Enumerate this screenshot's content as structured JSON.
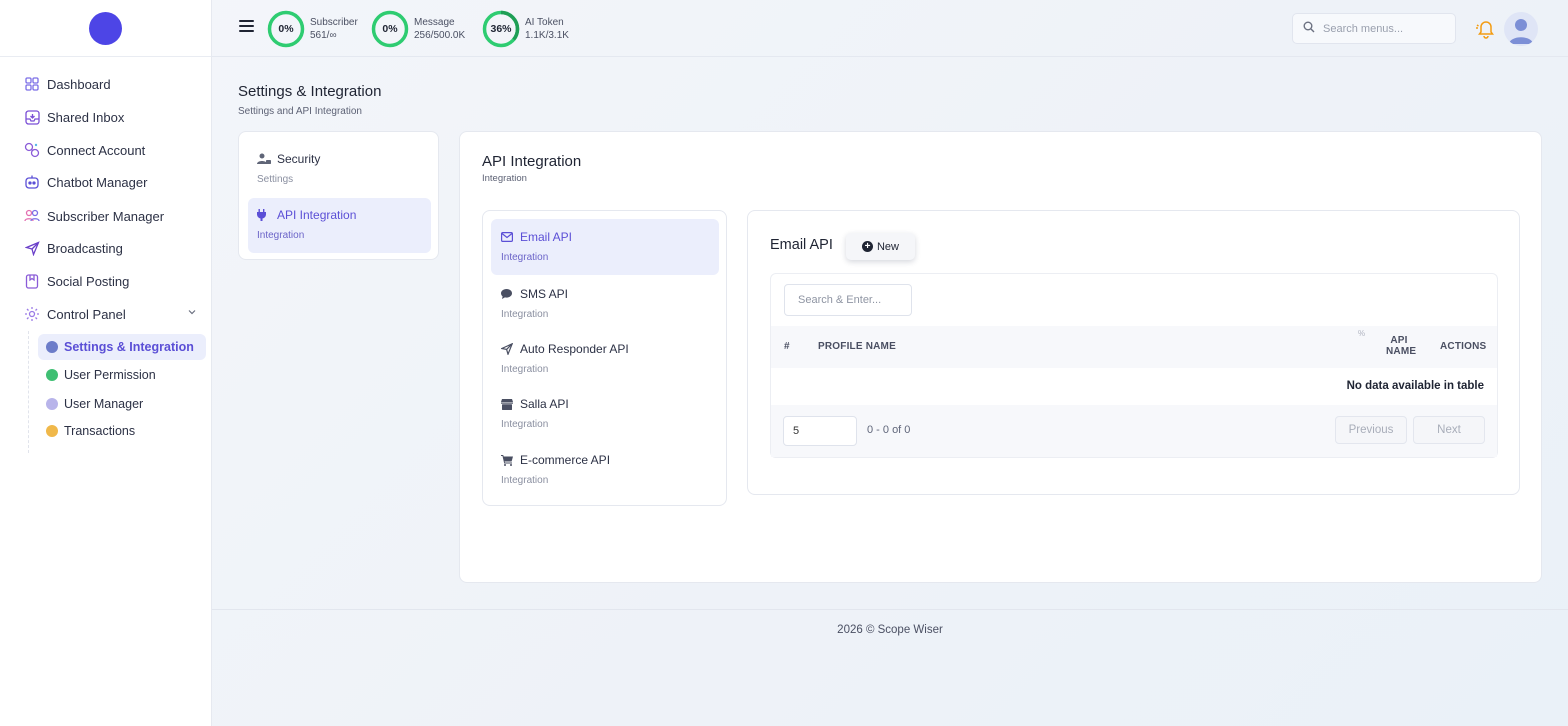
{
  "header": {
    "stats": [
      {
        "percent_label": "0%",
        "percent": 0,
        "name": "Subscriber",
        "value": "561/∞"
      },
      {
        "percent_label": "0%",
        "percent": 0,
        "name": "Message",
        "value": "256/500.0K"
      },
      {
        "percent_label": "36%",
        "percent": 36,
        "name": "AI Token",
        "value": "1.1K/3.1K"
      }
    ],
    "search_placeholder": "Search menus...",
    "ring_color": "#2ecc71",
    "bell_color": "#f39c12"
  },
  "sidebar": {
    "brand_color": "#4d45e6",
    "items": [
      {
        "label": "Dashboard",
        "icon": "grid-icon"
      },
      {
        "label": "Shared Inbox",
        "icon": "inbox-icon"
      },
      {
        "label": "Connect Account",
        "icon": "link-icon"
      },
      {
        "label": "Chatbot Manager",
        "icon": "bot-icon"
      },
      {
        "label": "Subscriber Manager",
        "icon": "users-icon"
      },
      {
        "label": "Broadcasting",
        "icon": "send-icon"
      },
      {
        "label": "Social Posting",
        "icon": "bookmark-icon"
      },
      {
        "label": "Control Panel",
        "icon": "gear-icon"
      }
    ],
    "sub_items": [
      {
        "label": "Settings & Integration",
        "active": true
      },
      {
        "label": "User Permission",
        "active": false
      },
      {
        "label": "User Manager",
        "active": false
      },
      {
        "label": "Transactions",
        "active": false
      }
    ]
  },
  "page": {
    "title": "Settings & Integration",
    "subtitle": "Settings and API Integration"
  },
  "settings_menu": [
    {
      "title": "Security",
      "subtitle": "Settings",
      "active": false
    },
    {
      "title": "API Integration",
      "subtitle": "Integration",
      "active": true
    }
  ],
  "main": {
    "title": "API Integration",
    "subtitle": "Integration",
    "api_items": [
      {
        "title": "Email API",
        "subtitle": "Integration",
        "active": true
      },
      {
        "title": "SMS API",
        "subtitle": "Integration",
        "active": false
      },
      {
        "title": "Auto Responder API",
        "subtitle": "Integration",
        "active": false
      },
      {
        "title": "Salla API",
        "subtitle": "Integration",
        "active": false
      },
      {
        "title": "E-commerce API",
        "subtitle": "Integration",
        "active": false
      }
    ]
  },
  "email_api": {
    "title": "Email API",
    "new_label": "New",
    "search_placeholder": "Search & Enter...",
    "columns": {
      "num": "#",
      "profile_name": "PROFILE NAME",
      "sort_mark": "%",
      "api_name_1": "API",
      "api_name_2": "NAME",
      "actions": "ACTIONS"
    },
    "empty_text": "No data available in table",
    "page_size": "5",
    "page_info": "0 - 0 of 0",
    "previous_label": "Previous",
    "next_label": "Next"
  },
  "footer": {
    "text": "2026 © Scope Wiser"
  }
}
